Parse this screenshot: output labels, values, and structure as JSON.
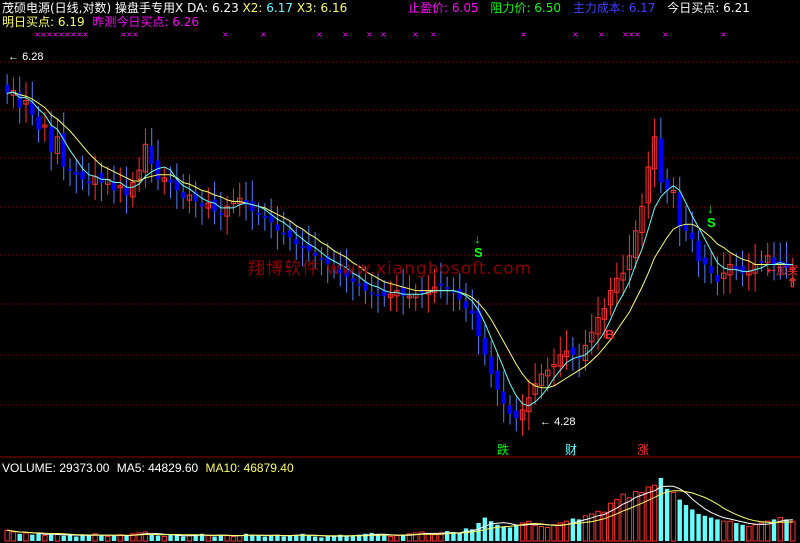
{
  "header": {
    "title": "茂硕电源(日线,对数)",
    "indicator_name": "操盘手专用X",
    "da_label": "DA:",
    "da_value": "6.23",
    "x2_label": "X2:",
    "x2_value": "6.17",
    "x3_label": "X3:",
    "x3_value": "6.16",
    "stop_label": "止盈价:",
    "stop_value": "6.05",
    "resist_label": "阻力价:",
    "resist_value": "6.50",
    "cost_label": "主力成本:",
    "cost_value": "6.17",
    "today_label": "今日买点:",
    "today_value": "6.21",
    "tomorrow_label": "明日买点:",
    "tomorrow_value": "6.19",
    "yesterday_label": "昨测今日买点:",
    "yesterday_value": "6.26"
  },
  "annotations": {
    "high_label": "6.28",
    "low_label": "4.28",
    "signal_s": "S",
    "signal_b": "B",
    "die": "跌",
    "cai": "财",
    "zhang": "涨",
    "right_edge": "←加买",
    "watermark": "翔博软件 www.xiangbosoft.com"
  },
  "volume": {
    "volume_label": "VOLUME:",
    "volume_value": "29373.00",
    "ma5_label": "MA5:",
    "ma5_value": "44829.60",
    "ma10_label": "MA10:",
    "ma10_value": "46879.40"
  },
  "colors": {
    "background": "#000000",
    "up": "#ff3030",
    "down": "#0000ff",
    "ma_yellow": "#ffff66",
    "ma_cyan": "#66ffff",
    "grid": "#8b0000",
    "magenta": "#ff00ff",
    "green": "#00ff00"
  },
  "chart_data": {
    "type": "candlestick",
    "scale": "log",
    "ylim": [
      4.28,
      6.5
    ],
    "highest": 6.28,
    "lowest": 4.28,
    "closes": [
      6.2,
      6.22,
      6.1,
      6.15,
      6.05,
      5.95,
      5.98,
      5.8,
      5.9,
      5.7,
      5.68,
      5.65,
      5.62,
      5.6,
      5.64,
      5.6,
      5.62,
      5.55,
      5.58,
      5.52,
      5.6,
      5.68,
      5.85,
      5.72,
      5.62,
      5.63,
      5.6,
      5.55,
      5.5,
      5.52,
      5.48,
      5.45,
      5.47,
      5.42,
      5.4,
      5.45,
      5.48,
      5.5,
      5.46,
      5.42,
      5.4,
      5.38,
      5.35,
      5.3,
      5.28,
      5.26,
      5.22,
      5.2,
      5.18,
      5.15,
      5.13,
      5.1,
      5.08,
      5.05,
      5.03,
      5.0,
      4.98,
      4.95,
      4.94,
      4.93,
      4.92,
      4.93,
      4.95,
      4.92,
      4.92,
      4.93,
      4.94,
      4.95,
      4.97,
      4.98,
      4.96,
      4.94,
      4.9,
      4.85,
      4.82,
      4.7,
      4.6,
      4.5,
      4.42,
      4.35,
      4.3,
      4.28,
      4.32,
      4.38,
      4.45,
      4.5,
      4.52,
      4.55,
      4.6,
      4.62,
      4.6,
      4.58,
      4.65,
      4.72,
      4.8,
      4.85,
      4.95,
      5.02,
      5.05,
      5.15,
      5.3,
      5.45,
      5.7,
      5.9,
      5.6,
      5.55,
      5.55,
      5.32,
      5.3,
      5.25,
      5.12,
      5.1,
      5.05,
      5.0,
      5.05,
      5.1,
      5.07,
      5.05,
      5.06,
      5.1,
      5.12,
      5.15,
      5.1,
      5.12,
      5.08,
      5.08
    ],
    "ma_fast": [
      6.2,
      6.21,
      6.17,
      6.17,
      6.14,
      6.09,
      6.05,
      5.98,
      5.95,
      5.88,
      5.81,
      5.75,
      5.69,
      5.65,
      5.64,
      5.62,
      5.62,
      5.6,
      5.6,
      5.57,
      5.57,
      5.59,
      5.64,
      5.67,
      5.69,
      5.7,
      5.68,
      5.62,
      5.58,
      5.56,
      5.53,
      5.5,
      5.48,
      5.47,
      5.44,
      5.44,
      5.44,
      5.46,
      5.47,
      5.46,
      5.45,
      5.43,
      5.4,
      5.37,
      5.35,
      5.32,
      5.28,
      5.25,
      5.22,
      5.2,
      5.17,
      5.14,
      5.12,
      5.1,
      5.08,
      5.05,
      5.03,
      5.0,
      4.98,
      4.97,
      4.95,
      4.94,
      4.94,
      4.93,
      4.93,
      4.93,
      4.93,
      4.94,
      4.95,
      4.95,
      4.95,
      4.95,
      4.94,
      4.92,
      4.89,
      4.84,
      4.77,
      4.69,
      4.61,
      4.53,
      4.45,
      4.39,
      4.35,
      4.34,
      4.36,
      4.39,
      4.43,
      4.48,
      4.52,
      4.56,
      4.58,
      4.59,
      4.6,
      4.63,
      4.67,
      4.72,
      4.79,
      4.87,
      4.93,
      5.0,
      5.1,
      5.19,
      5.31,
      5.44,
      5.51,
      5.55,
      5.58,
      5.55,
      5.47,
      5.39,
      5.32,
      5.25,
      5.18,
      5.11,
      5.08,
      5.07,
      5.07,
      5.06,
      5.06,
      5.07,
      5.08,
      5.1,
      5.1,
      5.11,
      5.1,
      5.1
    ],
    "ma_slow": [
      6.2,
      6.21,
      6.19,
      6.18,
      6.16,
      6.13,
      6.1,
      6.05,
      6.02,
      5.98,
      5.94,
      5.89,
      5.84,
      5.79,
      5.75,
      5.71,
      5.69,
      5.67,
      5.65,
      5.63,
      5.61,
      5.61,
      5.63,
      5.64,
      5.65,
      5.65,
      5.65,
      5.63,
      5.6,
      5.59,
      5.57,
      5.55,
      5.54,
      5.52,
      5.51,
      5.49,
      5.48,
      5.48,
      5.47,
      5.46,
      5.45,
      5.44,
      5.42,
      5.4,
      5.38,
      5.36,
      5.33,
      5.31,
      5.28,
      5.26,
      5.23,
      5.21,
      5.18,
      5.16,
      5.14,
      5.11,
      5.09,
      5.06,
      5.04,
      5.02,
      5.0,
      4.99,
      4.98,
      4.97,
      4.96,
      4.95,
      4.95,
      4.95,
      4.95,
      4.95,
      4.95,
      4.95,
      4.94,
      4.93,
      4.91,
      4.88,
      4.84,
      4.79,
      4.73,
      4.67,
      4.61,
      4.55,
      4.5,
      4.46,
      4.44,
      4.43,
      4.43,
      4.44,
      4.46,
      4.48,
      4.5,
      4.52,
      4.54,
      4.57,
      4.6,
      4.64,
      4.68,
      4.73,
      4.78,
      4.83,
      4.9,
      4.97,
      5.05,
      5.14,
      5.2,
      5.26,
      5.31,
      5.33,
      5.34,
      5.34,
      5.32,
      5.29,
      5.26,
      5.22,
      5.2,
      5.17,
      5.15,
      5.13,
      5.12,
      5.1,
      5.1,
      5.1,
      5.1,
      5.1,
      5.1,
      5.1
    ],
    "volumes": [
      12,
      10,
      8,
      9,
      7,
      8,
      6,
      7,
      8,
      6,
      7,
      5,
      6,
      7,
      8,
      6,
      5,
      6,
      7,
      6,
      8,
      9,
      10,
      8,
      6,
      5,
      7,
      6,
      5,
      6,
      7,
      8,
      6,
      5,
      7,
      6,
      5,
      6,
      8,
      7,
      6,
      5,
      6,
      7,
      5,
      6,
      7,
      8,
      6,
      5,
      4,
      5,
      6,
      7,
      5,
      6,
      7,
      8,
      9,
      7,
      6,
      5,
      6,
      7,
      8,
      9,
      10,
      8,
      7,
      9,
      11,
      10,
      9,
      14,
      13,
      20,
      26,
      22,
      18,
      16,
      15,
      18,
      20,
      22,
      17,
      16,
      15,
      18,
      20,
      22,
      25,
      24,
      28,
      30,
      33,
      32,
      42,
      46,
      52,
      48,
      55,
      54,
      60,
      62,
      70,
      58,
      54,
      46,
      40,
      35,
      30,
      28,
      26,
      24,
      22,
      22,
      20,
      18,
      16,
      18,
      20,
      22,
      24,
      26,
      24,
      22
    ],
    "volume_ma5": 44829.6,
    "volume_ma10": 46879.4,
    "volume_last": 29373.0
  }
}
